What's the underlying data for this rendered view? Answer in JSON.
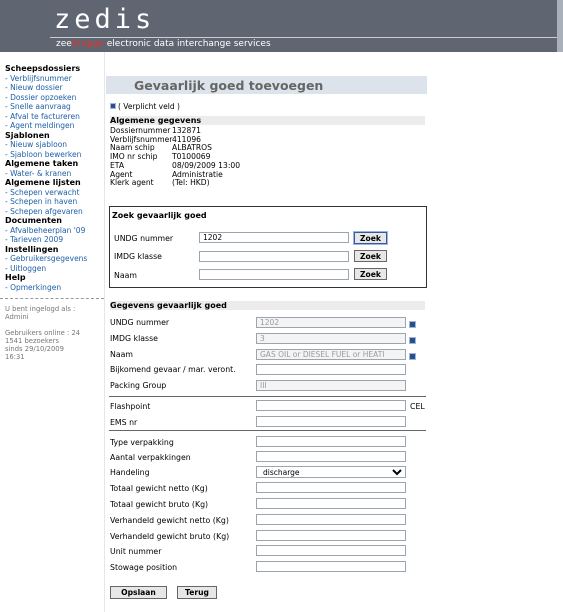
{
  "header": {
    "logo": "zedis",
    "tagline_zee": "zee",
    "tagline_brugge": "brugge",
    "tagline_rest": " electronic data interchange services"
  },
  "sidebar": {
    "sections": [
      {
        "title": "Scheepsdossiers",
        "items": [
          "- Verblijfsnummer",
          "- Nieuw dossier",
          "- Dossier opzoeken",
          "- Snelle aanvraag",
          "- Afval te factureren",
          "- Agent meldingen"
        ]
      },
      {
        "title": "Sjablonen",
        "items": [
          "- Nieuw sjabloon",
          "- Sjabloon bewerken"
        ]
      },
      {
        "title": "Algemene taken",
        "items": [
          "- Water- & kranen"
        ]
      },
      {
        "title": "Algemene lijsten",
        "items": [
          "- Schepen verwacht",
          "- Schepen in haven",
          "- Schepen afgevaren"
        ]
      },
      {
        "title": "Documenten",
        "items": [
          "- Afvalbeheerplan '09",
          "- Tarieven 2009"
        ]
      },
      {
        "title": "Instellingen",
        "items": [
          "- Gebruikersgegevens",
          "- Uitloggen"
        ]
      },
      {
        "title": "Help",
        "items": [
          "- Opmerkingen"
        ]
      }
    ],
    "footer": {
      "logged_in": "U bent ingelogd als :",
      "user": "Admini",
      "online": "Gebruikers online : 24",
      "visitors": "1541 bezoekers",
      "since": "sinds 29/10/2009",
      "time": "16:31"
    }
  },
  "main": {
    "title": "Gevaarlijk goed toevoegen",
    "required_note": "( Verplicht veld )",
    "general": {
      "header": "Algemene gegevens",
      "rows": [
        {
          "label": "Dossiernummer",
          "value": "132871"
        },
        {
          "label": "Verblijfsnummer",
          "value": "411096"
        },
        {
          "label": "Naam schip",
          "value": "ALBATROS"
        },
        {
          "label": "IMO nr schip",
          "value": "T0100069"
        },
        {
          "label": "ETA",
          "value": "08/09/2009 13:00"
        },
        {
          "label": "Agent",
          "value": "Administratie"
        },
        {
          "label": "Klerk agent",
          "value": "(Tel: HKD)"
        }
      ]
    },
    "search": {
      "header": "Zoek gevaarlijk goed",
      "undg_label": "UNDG nummer",
      "undg_value": "1202",
      "imdg_label": "IMDG klasse",
      "imdg_value": "",
      "name_label": "Naam",
      "name_value": "",
      "button": "Zoek"
    },
    "details": {
      "header": "Gegevens gevaarlijk goed",
      "undg_label": "UNDG nummer",
      "undg_value": "1202",
      "imdg_label": "IMDG klasse",
      "imdg_value": "3",
      "name_label": "Naam",
      "name_value": "GAS OIL or DIESEL FUEL or HEATI",
      "extra_label": "Bijkomend gevaar / mar. veront.",
      "extra_value": "",
      "packing_label": "Packing Group",
      "packing_value": "III",
      "flashpoint_label": "Flashpoint",
      "flashpoint_value": "",
      "flashpoint_unit": "CEL",
      "ems_label": "EMS nr",
      "ems_value": "",
      "type_label": "Type verpakking",
      "type_value": "",
      "aantal_label": "Aantal verpakkingen",
      "aantal_value": "",
      "handeling_label": "Handeling",
      "handeling_value": "discharge",
      "netto_label": "Totaal gewicht netto (Kg)",
      "netto_value": "",
      "bruto_label": "Totaal gewicht bruto (Kg)",
      "bruto_value": "",
      "vnetto_label": "Verhandeld gewicht netto (Kg)",
      "vnetto_value": "",
      "vbruto_label": "Verhandeld gewicht bruto (Kg)",
      "vbruto_value": "",
      "unit_label": "Unit nummer",
      "unit_value": "",
      "stowage_label": "Stowage position",
      "stowage_value": ""
    },
    "buttons": {
      "save": "Opslaan",
      "back": "Terug"
    }
  },
  "colors": {
    "header_bg": "#5f6672",
    "link": "#1f5fa7",
    "brugge_red": "#e8302a"
  }
}
